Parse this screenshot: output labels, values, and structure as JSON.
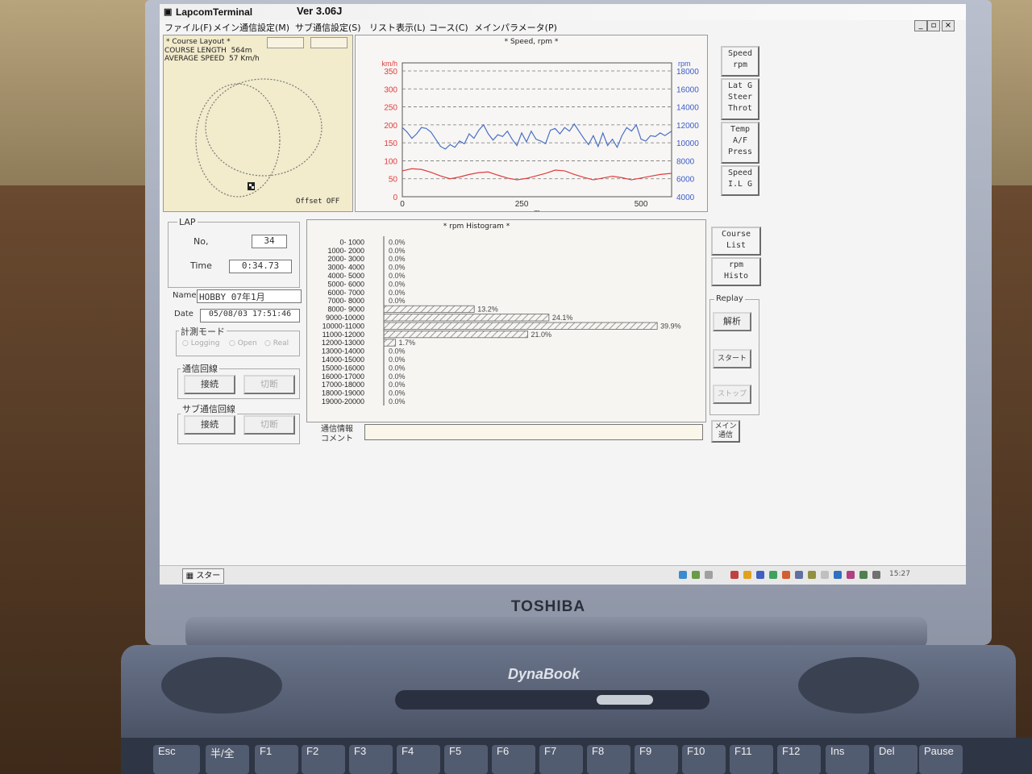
{
  "window": {
    "app_title": "LapcomTerminal",
    "version": "Ver 3.06J",
    "controls": [
      "_",
      "▫",
      "×"
    ]
  },
  "menu": [
    "ファイル(F)",
    "メイン通信設定(M)",
    "サブ通信設定(S)",
    "リスト表示(L)",
    "コース(C)",
    "メインパラメータ(P)"
  ],
  "course_layout": {
    "title": "* Course Layout *",
    "length_label": "COURSE LENGTH",
    "length_value": "564m",
    "speed_label": "AVERAGE SPEED",
    "speed_value": "57 Km/h",
    "offset_text": "Offset OFF"
  },
  "speed_panel": {
    "title": "*  Speed, rpm  *"
  },
  "side_buttons": [
    {
      "line1": "Speed",
      "line2": "rpm",
      "line3": ""
    },
    {
      "line1": "Lat G",
      "line2": "Steer",
      "line3": "Throt"
    },
    {
      "line1": "Temp",
      "line2": "A/F",
      "line3": "Press"
    },
    {
      "line1": "Speed",
      "line2": "I.L G",
      "line3": ""
    }
  ],
  "hist_buttons": [
    {
      "line1": "Course",
      "line2": "List"
    },
    {
      "line1": "rpm",
      "line2": "Histo"
    }
  ],
  "lap": {
    "group_title": "LAP",
    "no_label": "No,",
    "no_value": "34",
    "time_label": "Time",
    "time_value": "0:34.73"
  },
  "session": {
    "name_label": "Name",
    "name_value": "HOBBY  07年1月",
    "date_label": "Date",
    "date_value": "05/08/03 17:51:46"
  },
  "measure_mode": {
    "title": "計測モード",
    "options": [
      "Logging",
      "Open",
      "Real"
    ]
  },
  "comm_line": {
    "title": "通信回線",
    "connect": "接続",
    "disconnect": "切断"
  },
  "sub_comm_line": {
    "title": "サブ通信回線",
    "connect": "接続",
    "disconnect": "切断"
  },
  "replay": {
    "title": "Replay",
    "analyze": "解析",
    "start": "スタート",
    "stop": "ストップ"
  },
  "comm_info": {
    "label1": "通信情報",
    "label2": "コメント",
    "value": ""
  },
  "main_comm_button": {
    "line1": "メイン",
    "line2": "通信"
  },
  "histogram": {
    "title": "*   rpm Histogram   *"
  },
  "taskbar": {
    "start_label": "スタート",
    "clock": "15:27"
  },
  "laptop": {
    "brand": "TOSHIBA",
    "model": "DynaBook",
    "keys": [
      "Esc",
      "半/全",
      "F1",
      "F2",
      "F3",
      "F4",
      "F5",
      "F6",
      "F7",
      "F8",
      "F9",
      "F10",
      "F11",
      "F12",
      "Ins",
      "Del",
      "Pause"
    ]
  },
  "colors": {
    "speed_line": "#4a6fc4",
    "rpm_line": "#e03c3c",
    "speed_axis": "#e03c3c",
    "rpm_axis": "#3c5cc8"
  },
  "chart_data": [
    {
      "type": "line",
      "title": "Speed, rpm",
      "xlabel": "m",
      "x_ticks": [
        0,
        250,
        500
      ],
      "xlim": [
        0,
        564
      ],
      "y_left_label": "km/h",
      "y_left_ticks": [
        0,
        50,
        100,
        150,
        200,
        250,
        300,
        350
      ],
      "ylim_left": [
        0,
        350
      ],
      "y_right_label": "rpm",
      "y_right_ticks": [
        4000,
        6000,
        8000,
        10000,
        12000,
        14000,
        16000,
        18000
      ],
      "ylim_right": [
        4000,
        18000
      ],
      "grid": true,
      "series": [
        {
          "axis": "right",
          "x": [
            0,
            10,
            20,
            30,
            40,
            50,
            60,
            70,
            80,
            90,
            100,
            110,
            120,
            130,
            140,
            150,
            160,
            170,
            180,
            190,
            200,
            210,
            220,
            230,
            240,
            250,
            260,
            270,
            280,
            290,
            300,
            310,
            320,
            330,
            340,
            350,
            360,
            370,
            380,
            390,
            400,
            410,
            420,
            430,
            440,
            450,
            460,
            470,
            480,
            490,
            500,
            510,
            520,
            530,
            540,
            550,
            564
          ],
          "y": [
            11700,
            11200,
            10500,
            11000,
            11700,
            11600,
            11200,
            10400,
            9600,
            9300,
            9800,
            9500,
            10200,
            9900,
            11000,
            10500,
            11400,
            12000,
            11000,
            10300,
            10900,
            10700,
            11300,
            10400,
            9700,
            11100,
            10100,
            11300,
            10400,
            10200,
            9900,
            11400,
            11600,
            11000,
            11700,
            11300,
            12100,
            11300,
            10500,
            9800,
            10800,
            9600,
            11100,
            9700,
            10400,
            9500,
            10800,
            11700,
            11300,
            12000,
            10400,
            10200,
            10800,
            10700,
            11100,
            10800,
            11300
          ]
        },
        {
          "axis": "left",
          "x": [
            0,
            20,
            40,
            60,
            80,
            100,
            120,
            140,
            160,
            180,
            200,
            220,
            240,
            260,
            280,
            300,
            320,
            340,
            360,
            380,
            400,
            420,
            440,
            460,
            480,
            500,
            520,
            540,
            564
          ],
          "y": [
            72,
            78,
            76,
            68,
            58,
            50,
            55,
            62,
            67,
            69,
            60,
            52,
            47,
            51,
            58,
            65,
            74,
            72,
            62,
            54,
            47,
            52,
            57,
            53,
            47,
            52,
            57,
            62,
            65
          ]
        }
      ]
    },
    {
      "type": "bar",
      "orientation": "horizontal",
      "title": "rpm Histogram",
      "categories": [
        "0- 1000",
        "1000- 2000",
        "2000- 3000",
        "3000- 4000",
        "4000- 5000",
        "5000- 6000",
        "6000- 7000",
        "7000- 8000",
        "8000- 9000",
        "9000-10000",
        "10000-11000",
        "11000-12000",
        "12000-13000",
        "13000-14000",
        "14000-15000",
        "15000-16000",
        "16000-17000",
        "17000-18000",
        "18000-19000",
        "19000-20000"
      ],
      "values": [
        0.0,
        0.0,
        0.0,
        0.0,
        0.0,
        0.0,
        0.0,
        0.0,
        13.2,
        24.1,
        39.9,
        21.0,
        1.7,
        0.0,
        0.0,
        0.0,
        0.0,
        0.0,
        0.0,
        0.0
      ],
      "labels": [
        "0.0%",
        "0.0%",
        "0.0%",
        "0.0%",
        "0.0%",
        "0.0%",
        "0.0%",
        "0.0%",
        "13.2%",
        "24.1%",
        "39.9%",
        "21.0%",
        "1.7%",
        "0.0%",
        "0.0%",
        "0.0%",
        "0.0%",
        "0.0%",
        "0.0%",
        "0.0%"
      ],
      "xlim": [
        0,
        40
      ]
    }
  ]
}
